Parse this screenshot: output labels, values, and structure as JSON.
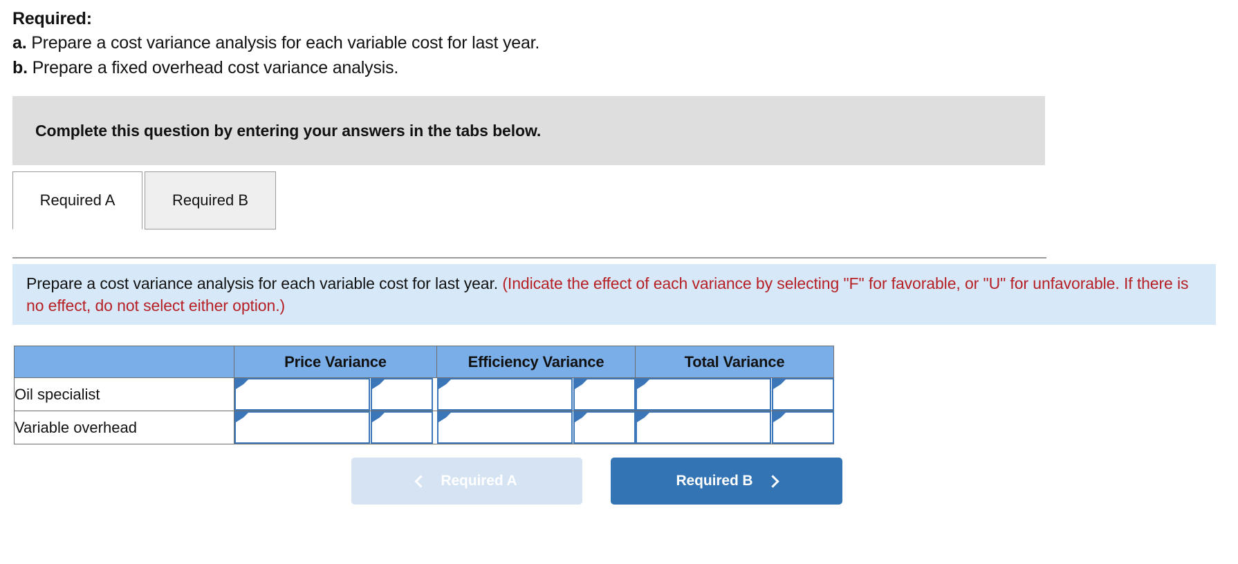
{
  "required": {
    "title": "Required:",
    "items": [
      {
        "label": "a.",
        "text": "Prepare a cost variance analysis for each variable cost for last year."
      },
      {
        "label": "b.",
        "text": "Prepare a fixed overhead cost variance analysis."
      }
    ]
  },
  "banner": {
    "text": "Complete this question by entering your answers in the tabs below."
  },
  "tabs": [
    {
      "id": "required-a",
      "label": "Required A",
      "active": true
    },
    {
      "id": "required-b",
      "label": "Required B",
      "active": false
    }
  ],
  "instruction": {
    "black": "Prepare a cost variance analysis for each variable cost for last year.",
    "red": "(Indicate the effect of each variance by selecting \"F\" for favorable, or \"U\" for unfavorable. If there is no effect, do not select either option.)",
    "red_color": "#b61f24",
    "panel_color": "#d7e9f8"
  },
  "table": {
    "header_color": "#7aaee8",
    "cell_border_color": "#3a76b8",
    "columns": [
      "",
      "Price Variance",
      "Efficiency Variance",
      "Total Variance"
    ],
    "rows": [
      {
        "label": "Oil specialist",
        "cells": [
          {
            "amount": "",
            "effect": ""
          },
          {
            "amount": "",
            "effect": ""
          },
          {
            "amount": "",
            "effect": ""
          }
        ]
      },
      {
        "label": "Variable overhead",
        "cells": [
          {
            "amount": "",
            "effect": ""
          },
          {
            "amount": "",
            "effect": ""
          },
          {
            "amount": "",
            "effect": ""
          }
        ]
      }
    ]
  },
  "nav": {
    "prev_label": "Required A",
    "next_label": "Required B",
    "prev_enabled": false,
    "next_color": "#3374b5",
    "prev_color": "#d5e3f2"
  }
}
